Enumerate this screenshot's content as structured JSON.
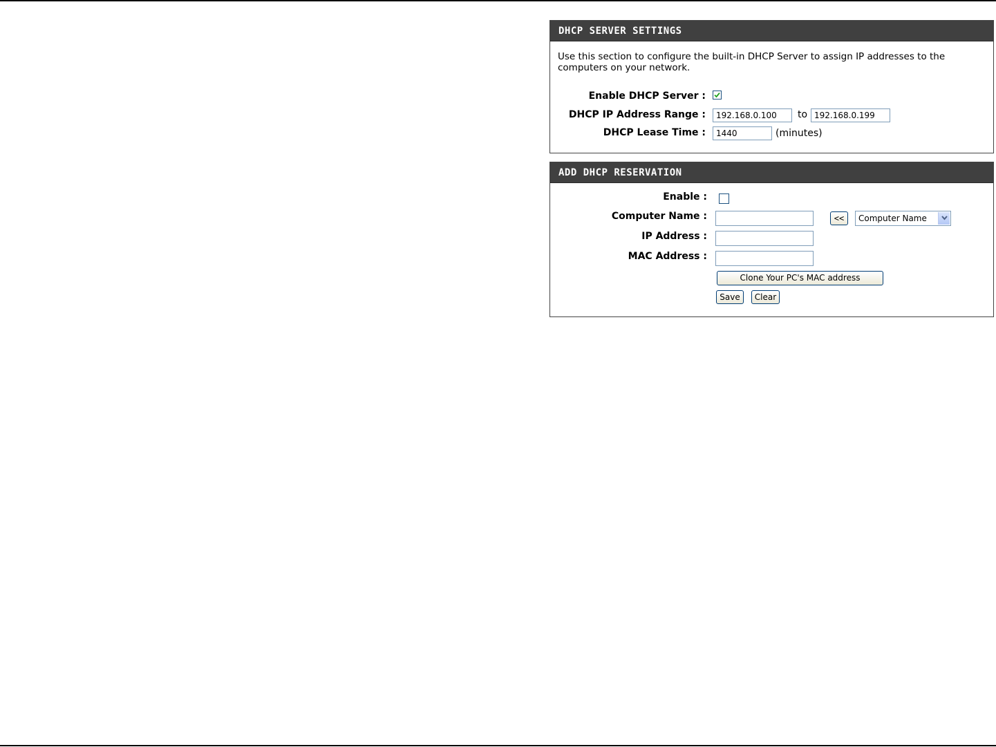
{
  "dhcp_server": {
    "header": "DHCP SERVER SETTINGS",
    "description": "Use this section to configure the built-in DHCP Server to assign IP addresses to the computers on your network.",
    "enable_label": "Enable DHCP Server :",
    "enable_checked": true,
    "range_label": "DHCP IP Address Range :",
    "range_start": "192.168.0.100",
    "range_to": "to",
    "range_end": "192.168.0.199",
    "lease_label": "DHCP Lease Time :",
    "lease_value": "1440",
    "lease_unit": "(minutes)"
  },
  "reservation": {
    "header": "ADD DHCP RESERVATION",
    "enable_label": "Enable :",
    "enable_checked": false,
    "computer_name_label": "Computer Name :",
    "computer_name_value": "",
    "copy_button": "<<",
    "computer_select_value": "Computer Name",
    "ip_label": "IP Address :",
    "ip_value": "",
    "mac_label": "MAC Address :",
    "mac_value": "",
    "clone_button": "Clone Your PC's MAC address",
    "save_button": "Save",
    "clear_button": "Clear"
  }
}
